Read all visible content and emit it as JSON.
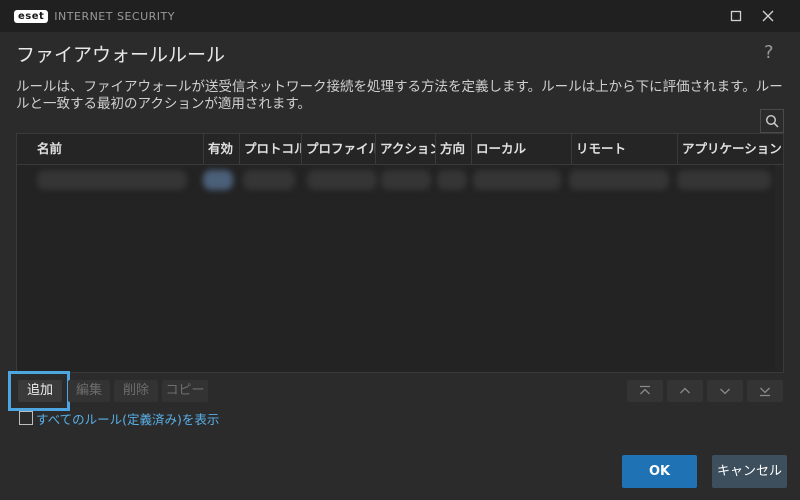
{
  "titlebar": {
    "logo_text": "eset",
    "product_name": "INTERNET SECURITY",
    "maximize_icon": "maximize-icon",
    "close_icon": "close-icon"
  },
  "dialog": {
    "title": "ファイアウォールルール",
    "help_label": "?",
    "description": "ルールは、ファイアウォールが送受信ネットワーク接続を処理する方法を定義します。ルールは上から下に評価されます。ルールと一致する最初のアクションが適用されます。"
  },
  "table": {
    "columns": [
      "名前",
      "有効",
      "プロトコル",
      "プロファイル",
      "アクション",
      "方向",
      "ローカル",
      "リモート",
      "アプリケーション"
    ]
  },
  "buttons": {
    "add": "追加",
    "edit": "編集",
    "delete": "削除",
    "copy": "コピー"
  },
  "checkbox": {
    "label": "すべてのルール(定義済み)を表示"
  },
  "footer": {
    "ok": "OK",
    "cancel": "キャンセル"
  },
  "colors": {
    "accent": "#1f72b3",
    "highlight": "#4da6e0",
    "link": "#5ab0e8"
  }
}
